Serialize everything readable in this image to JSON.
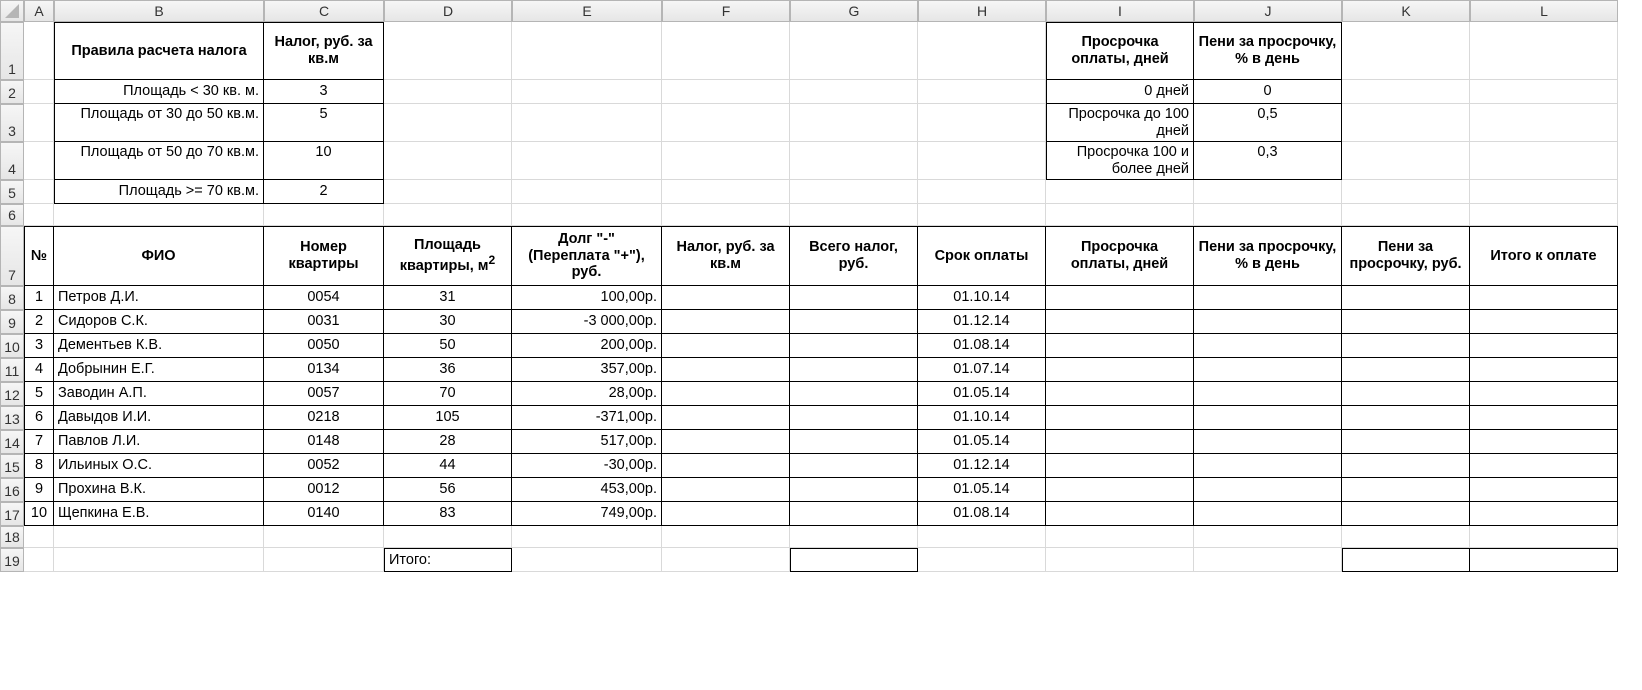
{
  "columns": [
    "A",
    "B",
    "C",
    "D",
    "E",
    "F",
    "G",
    "H",
    "I",
    "J",
    "K",
    "L"
  ],
  "rowLabels": [
    "1",
    "2",
    "3",
    "4",
    "5",
    "6",
    "7",
    "8",
    "9",
    "10",
    "11",
    "12",
    "13",
    "14",
    "15",
    "16",
    "17",
    "18",
    "19"
  ],
  "topLeft": {
    "header_rule": "Правила расчета налога",
    "header_tax": "Налог, руб. за кв.м",
    "rows": [
      {
        "rule": "Площадь < 30 кв. м.",
        "tax": "3"
      },
      {
        "rule": "Площадь от 30 до 50 кв.м.",
        "tax": "5"
      },
      {
        "rule": "Площадь от 50 до 70 кв.м.",
        "tax": "10"
      },
      {
        "rule": "Площадь >= 70 кв.м.",
        "tax": "2"
      }
    ]
  },
  "topRight": {
    "header_delay": "Просрочка оплаты, дней",
    "header_penalty": "Пени за просрочку, % в день",
    "rows": [
      {
        "delay": "0 дней",
        "penalty": "0"
      },
      {
        "delay": "Просрочка до 100 дней",
        "penalty": "0,5"
      },
      {
        "delay": "Просрочка 100 и более дней",
        "penalty": "0,3"
      }
    ]
  },
  "tableHeaders": {
    "n": "№",
    "fio": "ФИО",
    "apt": "Номер квартиры",
    "area_pre": "Площадь квартиры, м",
    "area_sup": "2",
    "debt": "Долг \"-\" (Переплата \"+\"), руб.",
    "taxm2": "Налог, руб. за кв.м",
    "taxtot": "Всего налог, руб.",
    "due": "Срок оплаты",
    "delay": "Просрочка оплаты, дней",
    "penpct": "Пени за просрочку, % в день",
    "penrub": "Пени за просрочку, руб.",
    "total": "Итого к оплате"
  },
  "records": [
    {
      "n": "1",
      "fio": "Петров Д.И.",
      "apt": "0054",
      "area": "31",
      "debt": "100,00р.",
      "due": "01.10.14"
    },
    {
      "n": "2",
      "fio": "Сидоров С.К.",
      "apt": "0031",
      "area": "30",
      "debt": "-3 000,00р.",
      "due": "01.12.14"
    },
    {
      "n": "3",
      "fio": "Дементьев К.В.",
      "apt": "0050",
      "area": "50",
      "debt": "200,00р.",
      "due": "01.08.14"
    },
    {
      "n": "4",
      "fio": "Добрынин Е.Г.",
      "apt": "0134",
      "area": "36",
      "debt": "357,00р.",
      "due": "01.07.14"
    },
    {
      "n": "5",
      "fio": "Заводин А.П.",
      "apt": "0057",
      "area": "70",
      "debt": "28,00р.",
      "due": "01.05.14"
    },
    {
      "n": "6",
      "fio": "Давыдов И.И.",
      "apt": "0218",
      "area": "105",
      "debt": "-371,00р.",
      "due": "01.10.14"
    },
    {
      "n": "7",
      "fio": "Павлов Л.И.",
      "apt": "0148",
      "area": "28",
      "debt": "517,00р.",
      "due": "01.05.14"
    },
    {
      "n": "8",
      "fio": "Ильиных О.С.",
      "apt": "0052",
      "area": "44",
      "debt": "-30,00р.",
      "due": "01.12.14"
    },
    {
      "n": "9",
      "fio": "Прохина В.К.",
      "apt": "0012",
      "area": "56",
      "debt": "453,00р.",
      "due": "01.05.14"
    },
    {
      "n": "10",
      "fio": "Щепкина Е.В.",
      "apt": "0140",
      "area": "83",
      "debt": "749,00р.",
      "due": "01.08.14"
    }
  ],
  "footer": {
    "label": "Итого:"
  }
}
